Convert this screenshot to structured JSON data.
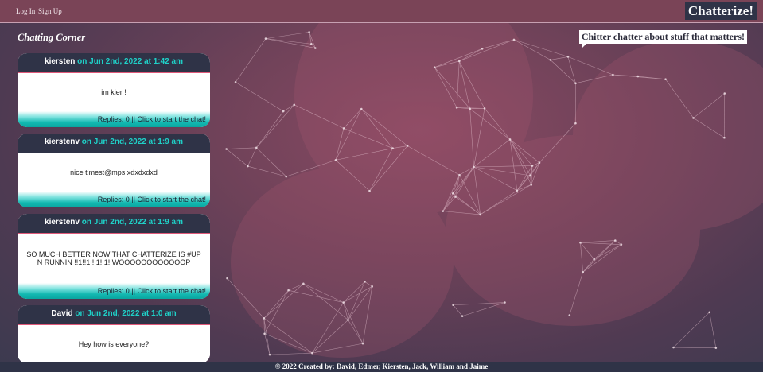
{
  "nav": {
    "login_label": "Log In",
    "signup_label": "Sign Up"
  },
  "brand": {
    "title": "Chatterize!"
  },
  "page": {
    "section_title": "Chatting Corner",
    "tagline": "Chitter chatter about stuff that matters!"
  },
  "posts": [
    {
      "author": "kiersten",
      "date": "on Jun 2nd, 2022 at 1:42 am",
      "body": "im kier !",
      "footer": "Replies: 0 || Click to start the chat!"
    },
    {
      "author": "kierstenv",
      "date": "on Jun 2nd, 2022 at 1:9 am",
      "body": "nice timest@mps xdxdxdxd",
      "footer": "Replies: 0 || Click to start the chat!"
    },
    {
      "author": "kierstenv",
      "date": "on Jun 2nd, 2022 at 1:9 am",
      "body": "SO MUCH BETTER NOW THAT CHATTERIZE IS #UP N RUNNIN !!1!!1!!!1!!1! WOOOOOOOOOOOOP",
      "footer": "Replies: 0 || Click to start the chat!"
    },
    {
      "author": "David",
      "date": "on Jun 2nd, 2022 at 1:0 am",
      "body": "Hey how is everyone?",
      "footer": ""
    }
  ],
  "footer": {
    "text": "© 2022 Created by: David, Edmer, Kiersten, Jack, William and Jaime"
  },
  "colors": {
    "accent_teal": "#1fd1c8",
    "header_dark": "#2f3347",
    "topbar": "#7a4457",
    "header_border_pink": "#e05a7a"
  }
}
